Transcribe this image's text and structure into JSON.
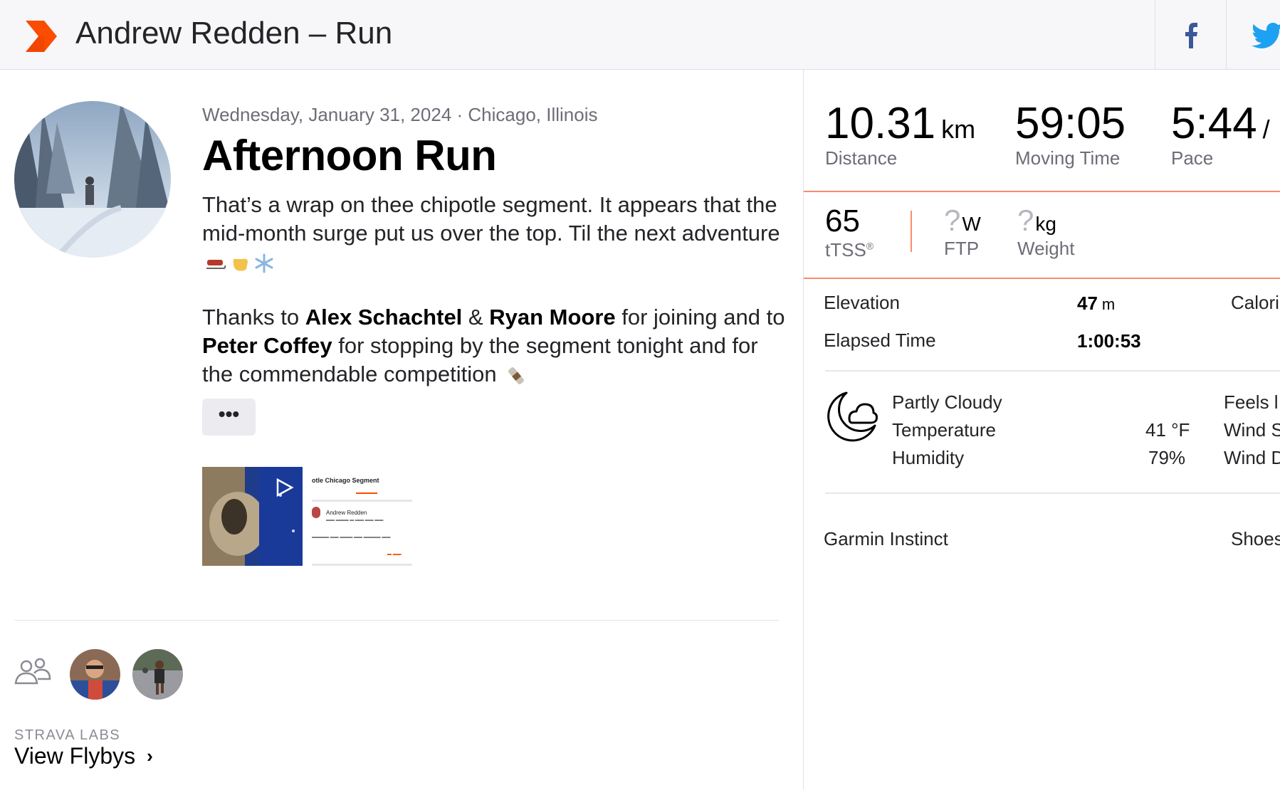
{
  "header": {
    "title": "Andrew Redden – Run",
    "share": [
      "facebook-icon",
      "twitter-icon"
    ],
    "brand_color": "#fc4c02"
  },
  "activity": {
    "date_location": "Wednesday, January 31, 2024 · Chicago, Illinois",
    "title": "Afternoon Run",
    "description_1": "That’s a wrap on thee chipotle segment. It appears that the mid-month surge put us over the top. Til the next adventure",
    "description_2_parts": [
      "Thanks to ",
      "Alex Schachtel",
      " & ",
      "Ryan Moore",
      " for joining and to ",
      "Peter Coffey",
      " for stopping by the segment tonight and for the commendable competition"
    ],
    "more_button": "•••",
    "media_thumb": {
      "title": "otle Chicago Segment",
      "athlete": "Andrew Redden"
    }
  },
  "social": {
    "labs_label": "STRAVA LABS",
    "flybys_label": "View Flybys"
  },
  "stats": {
    "primary": [
      {
        "value": "10.31",
        "unit": "km",
        "label": "Distance"
      },
      {
        "value": "59:05",
        "unit": "",
        "label": "Moving Time"
      },
      {
        "value": "5:44",
        "unit": "/",
        "label": "Pace"
      }
    ],
    "secondary": {
      "tss_value": "65",
      "tss_label": "tTSS",
      "tss_mark": "®",
      "ftp_value": "?",
      "ftp_unit": "W",
      "ftp_label": "FTP",
      "weight_value": "?",
      "weight_unit": "kg",
      "weight_label": "Weight"
    },
    "details": {
      "elevation_label": "Elevation",
      "elevation_value": "47",
      "elevation_unit": "m",
      "calories_label": "Calori",
      "elapsed_label": "Elapsed Time",
      "elapsed_value": "1:00:53"
    },
    "weather": {
      "condition": "Partly Cloudy",
      "temperature_label": "Temperature",
      "temperature_value": "41 °F",
      "humidity_label": "Humidity",
      "humidity_value": "79%",
      "feels_label": "Feels l",
      "wind_speed_label": "Wind S",
      "wind_dir_label": "Wind D"
    },
    "device": "Garmin Instinct",
    "shoes_label": "Shoes"
  }
}
